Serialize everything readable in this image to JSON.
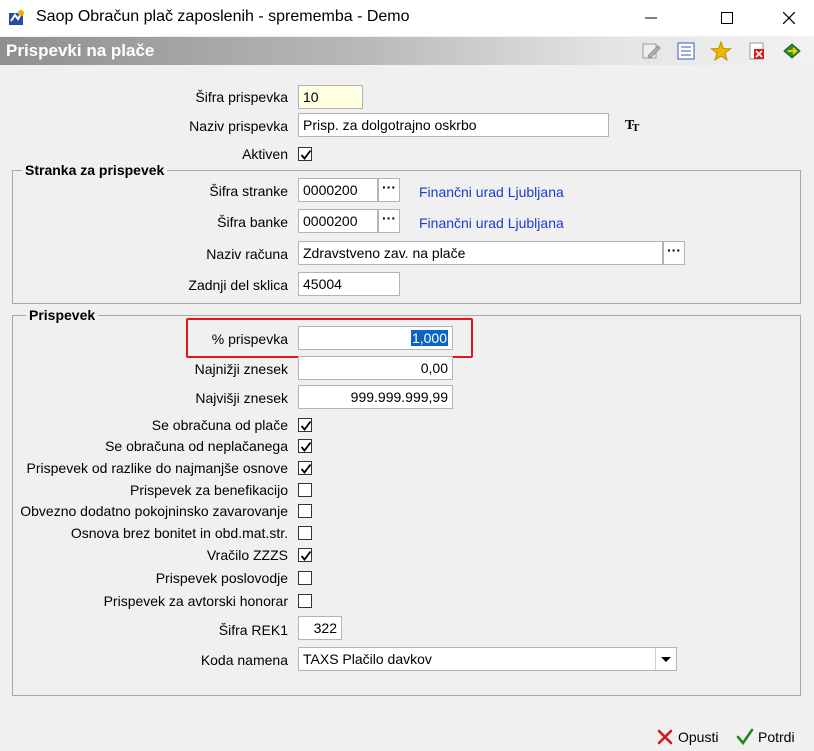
{
  "window": {
    "title": "Saop Obračun plač zaposlenih - sprememba - Demo"
  },
  "header": {
    "title": "Prispevki na plače",
    "tools": [
      "edit-icon",
      "list-icon",
      "star-icon",
      "delete-icon",
      "exit-icon"
    ]
  },
  "top_fields": {
    "sifra_label": "Šifra prispevka",
    "sifra_value": "10",
    "naziv_label": "Naziv prispevka",
    "naziv_value": "Prisp. za dolgotrajno oskrbo",
    "aktiven_label": "Aktiven",
    "aktiven_checked": true
  },
  "stranka": {
    "title": "Stranka za prispevek",
    "sifra_stranke_label": "Šifra stranke",
    "sifra_stranke_value": "0000200",
    "sifra_stranke_name": "Finančni urad Ljubljana",
    "sifra_banke_label": "Šifra banke",
    "sifra_banke_value": "0000200",
    "sifra_banke_name": "Finančni urad Ljubljana",
    "naziv_racuna_label": "Naziv računa",
    "naziv_racuna_value": "Zdravstveno zav. na plače",
    "sklic_label": "Zadnji del sklica",
    "sklic_value": "45004",
    "dots": "···"
  },
  "prispevek": {
    "title": "Prispevek",
    "pct_label": "% prispevka",
    "pct_value": "1,000",
    "min_label": "Najnižji znesek",
    "min_value": "0,00",
    "max_label": "Najvišji znesek",
    "max_value": "999.999.999,99",
    "checkboxes": [
      {
        "label": "Se obračuna od plače",
        "checked": true
      },
      {
        "label": "Se obračuna od neplačanega",
        "checked": true
      },
      {
        "label": "Prispevek od razlike do najmanjše osnove",
        "checked": true
      },
      {
        "label": "Prispevek za benefikacijo",
        "checked": false
      },
      {
        "label": "Obvezno dodatno pokojninsko zavarovanje",
        "checked": false
      },
      {
        "label": "Osnova brez bonitet in obd.mat.str.",
        "checked": false
      },
      {
        "label": "Vračilo ZZZS",
        "checked": true
      },
      {
        "label": "Prispevek poslovodje",
        "checked": false
      },
      {
        "label": "Prispevek za avtorski honorar",
        "checked": false
      }
    ],
    "rek1_label": "Šifra REK1",
    "rek1_value": "322",
    "koda_label": "Koda namena",
    "koda_value": "TAXS Plačilo davkov"
  },
  "buttons": {
    "cancel": "Opusti",
    "confirm": "Potrdi"
  },
  "colors": {
    "link": "#1a3bcc",
    "highlight": "#e0161b",
    "selection": "#0a64c8",
    "yellow_field": "#ffffe1"
  }
}
